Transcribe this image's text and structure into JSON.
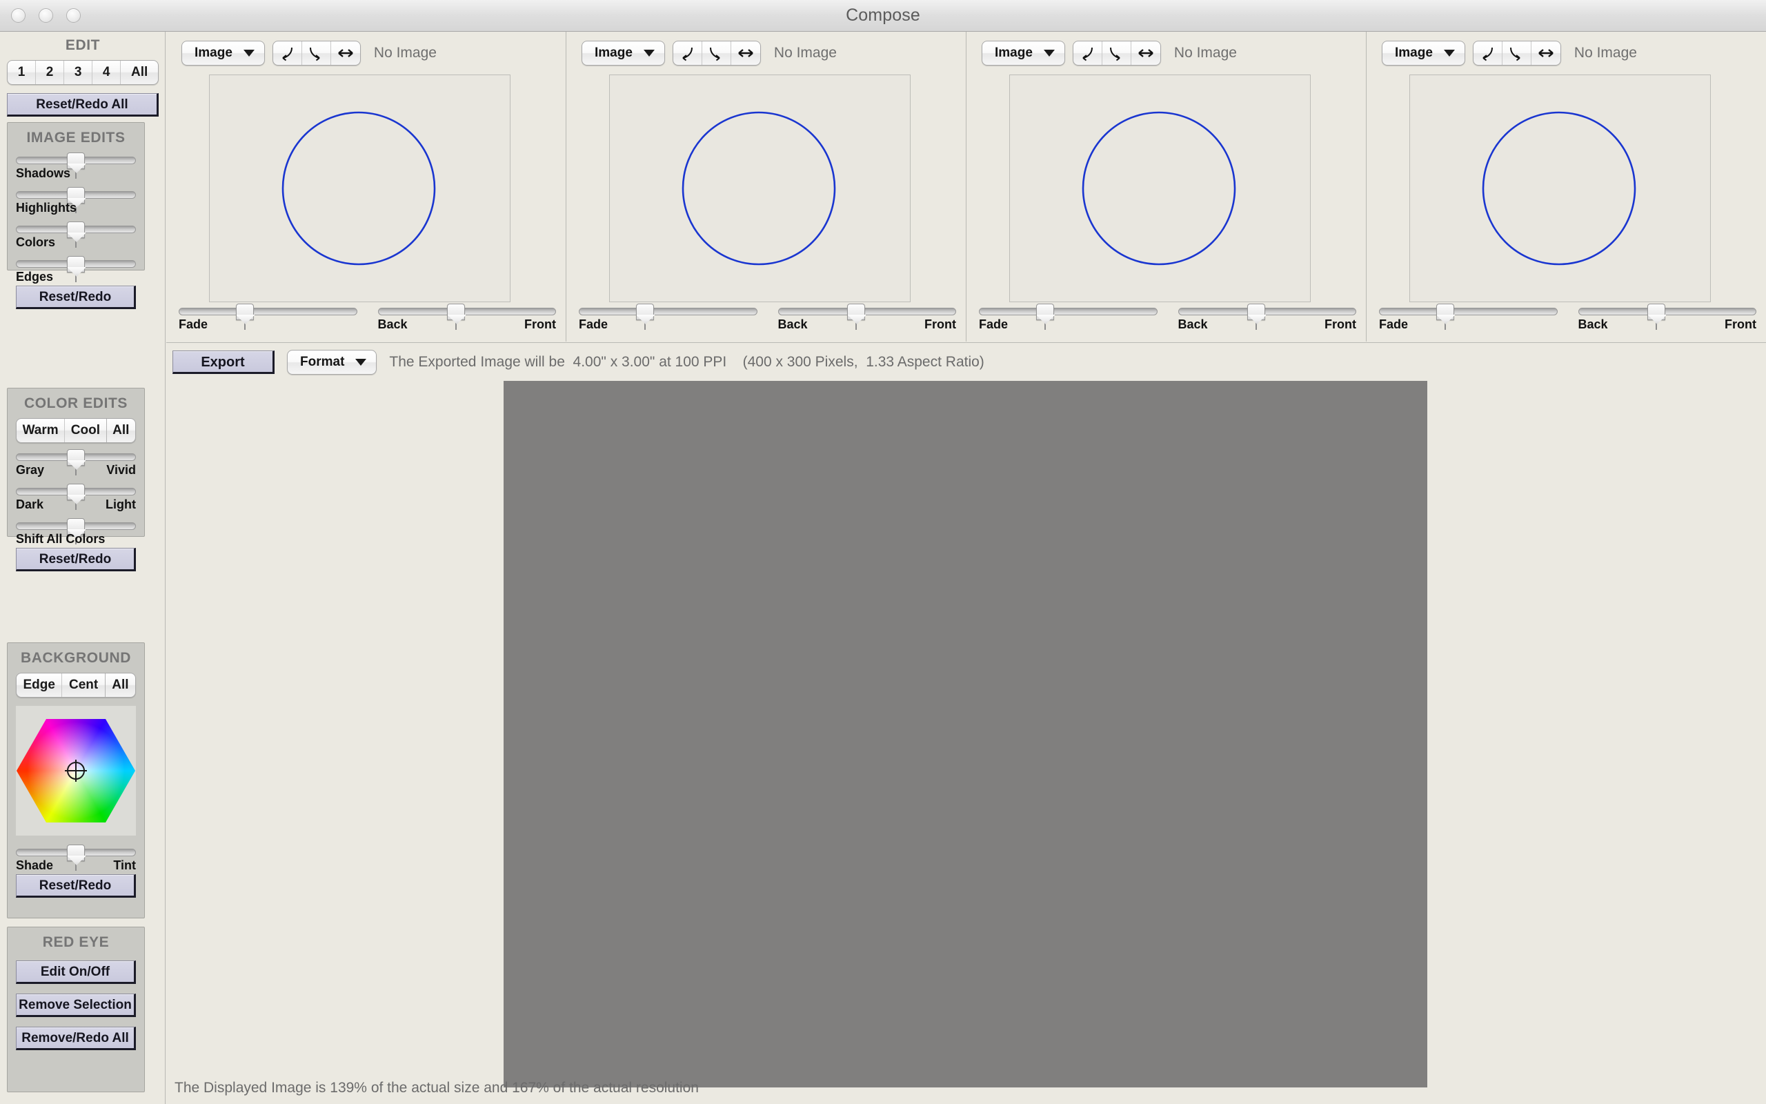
{
  "window": {
    "title": "Compose",
    "traffic_lights": [
      "close",
      "minimize",
      "zoom"
    ]
  },
  "sidebar": {
    "edit": {
      "title": "EDIT",
      "segments": [
        "1",
        "2",
        "3",
        "4",
        "All"
      ],
      "reset_label": "Reset/Redo All"
    },
    "image_edits": {
      "title": "IMAGE EDITS",
      "sliders": [
        {
          "left_label": "Shadows",
          "right_label": "",
          "value": 50
        },
        {
          "left_label": "Highlights",
          "right_label": "",
          "value": 50
        },
        {
          "left_label": "Colors",
          "right_label": "",
          "value": 50
        },
        {
          "left_label": "Edges",
          "right_label": "",
          "value": 50
        }
      ],
      "reset_label": "Reset/Redo"
    },
    "color_edits": {
      "title": "COLOR EDITS",
      "segments": [
        "Warm",
        "Cool",
        "All"
      ],
      "sliders": [
        {
          "left_label": "Gray",
          "right_label": "Vivid",
          "value": 50
        },
        {
          "left_label": "Dark",
          "right_label": "Light",
          "value": 50
        },
        {
          "left_label": "Shift All Colors",
          "right_label": "",
          "value": 50
        }
      ],
      "reset_label": "Reset/Redo"
    },
    "background": {
      "title": "BACKGROUND",
      "segments": [
        "Edge",
        "Cent",
        "All"
      ],
      "picker": "hexagon-color-wheel",
      "slider": {
        "left_label": "Shade",
        "right_label": "Tint",
        "value": 50
      },
      "reset_label": "Reset/Redo"
    },
    "red_eye": {
      "title": "RED EYE",
      "buttons": [
        "Edit On/Off",
        "Remove Selection",
        "Remove/Redo All"
      ]
    }
  },
  "panels": [
    {
      "source_label": "Image",
      "status": "No Image",
      "rotate_left_icon": "rotate-left-icon",
      "rotate_right_icon": "rotate-right-icon",
      "flip_icon": "flip-horizontal-icon",
      "shape": "circle",
      "shape_color": "#1a36d0",
      "fade": {
        "left_label": "Fade",
        "right_label": "",
        "value": 37
      },
      "depth": {
        "left_label": "Back",
        "right_label": "Front",
        "value": 44
      }
    },
    {
      "source_label": "Image",
      "status": "No Image",
      "rotate_left_icon": "rotate-left-icon",
      "rotate_right_icon": "rotate-right-icon",
      "flip_icon": "flip-horizontal-icon",
      "shape": "circle",
      "shape_color": "#1a36d0",
      "fade": {
        "left_label": "Fade",
        "right_label": "",
        "value": 37
      },
      "depth": {
        "left_label": "Back",
        "right_label": "Front",
        "value": 44
      }
    },
    {
      "source_label": "Image",
      "status": "No Image",
      "rotate_left_icon": "rotate-left-icon",
      "rotate_right_icon": "rotate-right-icon",
      "flip_icon": "flip-horizontal-icon",
      "shape": "circle",
      "shape_color": "#1a36d0",
      "fade": {
        "left_label": "Fade",
        "right_label": "",
        "value": 37
      },
      "depth": {
        "left_label": "Back",
        "right_label": "Front",
        "value": 44
      }
    },
    {
      "source_label": "Image",
      "status": "No Image",
      "rotate_left_icon": "rotate-left-icon",
      "rotate_right_icon": "rotate-right-icon",
      "flip_icon": "flip-horizontal-icon",
      "shape": "circle",
      "shape_color": "#1a36d0",
      "fade": {
        "left_label": "Fade",
        "right_label": "",
        "value": 37
      },
      "depth": {
        "left_label": "Back",
        "right_label": "Front",
        "value": 44
      }
    }
  ],
  "export": {
    "button_label": "Export",
    "format_label": "Format",
    "note": "The Exported Image will be  4.00\" x 3.00\" at 100 PPI    (400 x 300 Pixels,  1.33 Aspect Ratio)"
  },
  "canvas": {
    "background_color": "#807f7e"
  },
  "status": {
    "text": "The Displayed Image is 139% of the actual size and 167% of the actual resolution"
  },
  "colors": {
    "app_background": "#ebe9e1",
    "group_background": "#c9c9c4",
    "accent_button": "#c9c9dd",
    "shape_blue": "#1a36d0",
    "canvas_gray": "#807f7e"
  }
}
